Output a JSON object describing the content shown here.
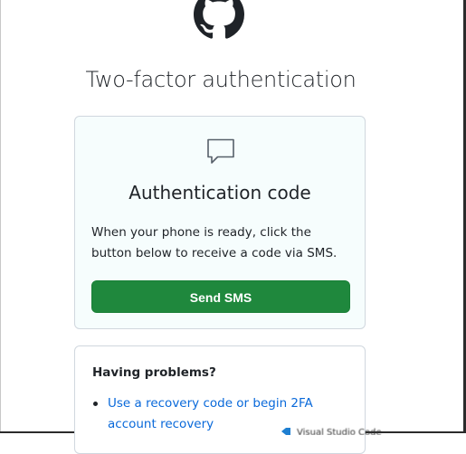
{
  "page": {
    "title": "Two-factor authentication"
  },
  "auth_box": {
    "icon": "chat-bubble-icon",
    "heading": "Authentication code",
    "description": "When your phone is ready, click the button below to receive a code via SMS.",
    "button_label": "Send SMS"
  },
  "problems_box": {
    "heading": "Having problems?",
    "items": [
      {
        "label": "Use a recovery code or begin 2FA account recovery"
      }
    ]
  },
  "overlay": {
    "icon": "visual-studio-code-icon",
    "text": "Visual Studio Code"
  },
  "colors": {
    "primary_button": "#1f883d",
    "link": "#0969da",
    "text": "#1f2328",
    "border": "#d0d7de",
    "box_background": "#f6fdfd"
  }
}
